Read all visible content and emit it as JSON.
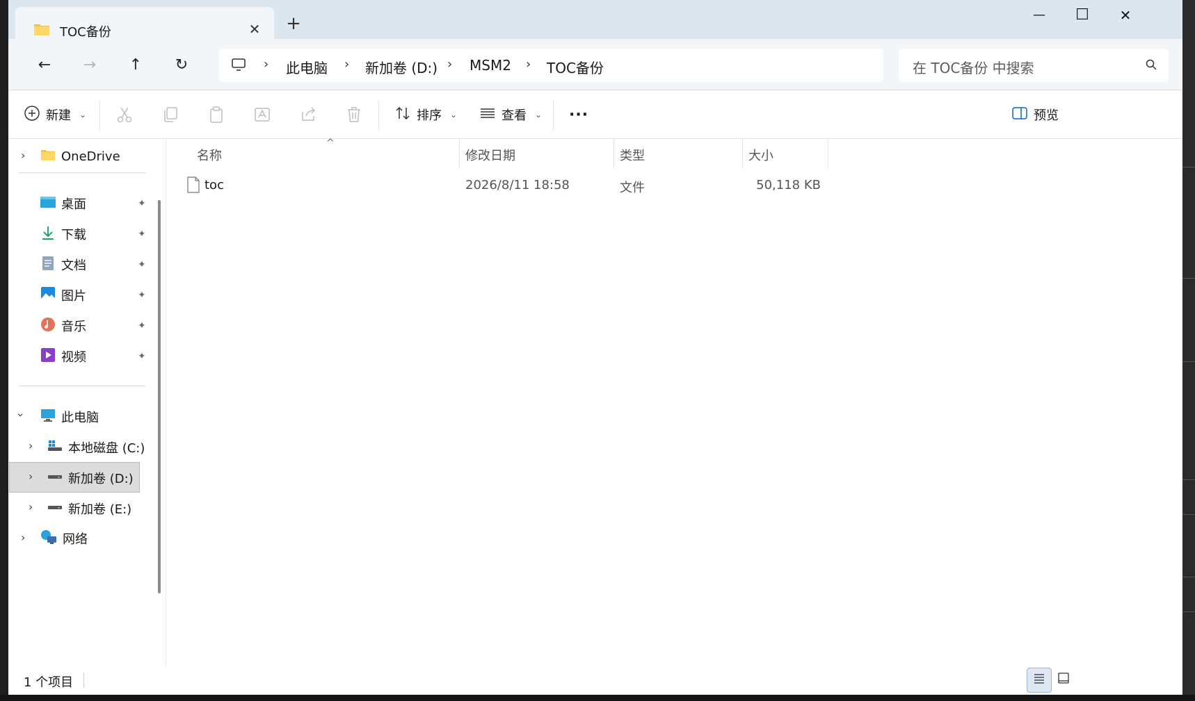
{
  "window": {
    "tab_title": "TOC备份",
    "tab_close": "✕",
    "new_tab": "+",
    "minimize": "—",
    "maximize": "☐",
    "close": "✕"
  },
  "nav": {
    "back": "←",
    "forward": "→",
    "up": "↑",
    "refresh": "↻",
    "breadcrumb": [
      "此电脑",
      "新加卷 (D:)",
      "MSM2",
      "TOC备份"
    ],
    "separator": "›",
    "search_placeholder": "在 TOC备份 中搜索"
  },
  "toolbar": {
    "new_label": "新建",
    "sort_label": "排序",
    "view_label": "查看",
    "more_label": "···",
    "preview_label": "预览",
    "dropdown_chevron": "⌄"
  },
  "sidebar": {
    "onedrive": "OneDrive",
    "quick_access": [
      {
        "label": "桌面",
        "icon": "desktop-icon"
      },
      {
        "label": "下载",
        "icon": "download-icon"
      },
      {
        "label": "文档",
        "icon": "documents-icon"
      },
      {
        "label": "图片",
        "icon": "pictures-icon"
      },
      {
        "label": "音乐",
        "icon": "music-icon"
      },
      {
        "label": "视频",
        "icon": "videos-icon"
      }
    ],
    "this_pc": "此电脑",
    "drives": [
      "本地磁盘 (C:)",
      "新加卷 (D:)",
      "新加卷 (E:)"
    ],
    "network": "网络",
    "pin_glyph": "📌"
  },
  "columns": {
    "name": "名称",
    "modified": "修改日期",
    "type": "类型",
    "size": "大小",
    "sort_indicator": "^"
  },
  "files": [
    {
      "name": "toc",
      "modified": "2026/8/11 18:58",
      "type": "文件",
      "size": "50,118 KB"
    }
  ],
  "status": {
    "item_count": "1 个项目"
  }
}
